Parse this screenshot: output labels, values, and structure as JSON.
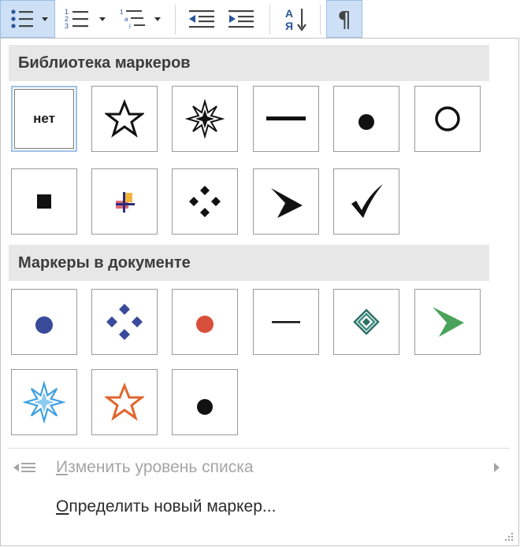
{
  "toolbar": {
    "buttons": [
      {
        "name": "bullets-button",
        "icon": "bullets-icon",
        "active": true
      },
      {
        "name": "numbering-button",
        "icon": "numbering-icon"
      },
      {
        "name": "multilevel-list-button",
        "icon": "multilevel-list-icon"
      },
      {
        "name": "decrease-indent-button",
        "icon": "decrease-indent-icon"
      },
      {
        "name": "increase-indent-button",
        "icon": "increase-indent-icon"
      },
      {
        "name": "sort-button",
        "icon": "sort-icon"
      },
      {
        "name": "show-formatting-button",
        "icon": "pilcrow-icon",
        "active": true
      }
    ],
    "sort_letters": {
      "top": "А",
      "bottom": "Я"
    },
    "pilcrow": "¶"
  },
  "library": {
    "title": "Библиотека маркеров",
    "none_label": "нет",
    "items": [
      "none",
      "star-outline",
      "star-8-point",
      "dash",
      "dot",
      "circle-outline",
      "square",
      "picture-cross",
      "diamond-4",
      "arrowhead",
      "checkmark"
    ]
  },
  "document": {
    "title": "Маркеры в документе",
    "items": [
      "dot-blue",
      "diamond-4-blue",
      "dot-red",
      "dash-thin",
      "diamond-green-concentric",
      "arrowhead-green",
      "star-8-blue",
      "star-outline-orange",
      "dot-black"
    ]
  },
  "menu": {
    "change_level_mnemonic": "И",
    "change_level_rest": "зменить уровень списка",
    "define_new_mnemonic": "О",
    "define_new_rest": "пределить новый маркер..."
  },
  "colors": {
    "accent_bg": "#cde0f5",
    "selected_border": "#9fc1e9",
    "blue": "#3a4a9a",
    "red": "#d9503a",
    "green": "#4aa35c",
    "light_blue": "#3d9fe0",
    "orange": "#e0662e",
    "disabled_text": "#a5a5a5"
  }
}
